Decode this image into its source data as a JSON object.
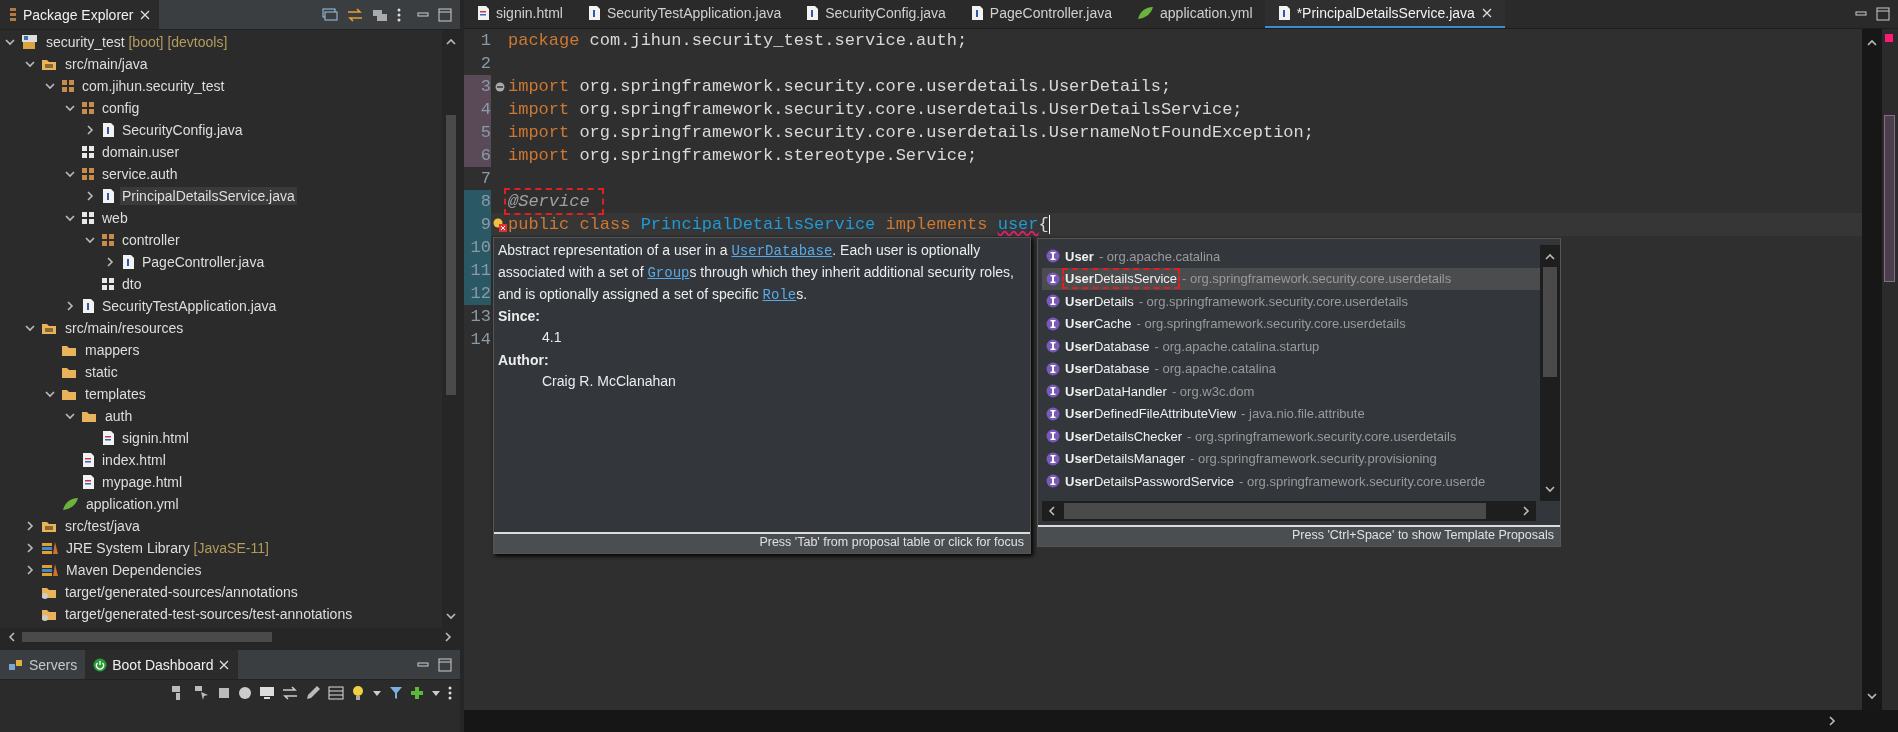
{
  "explorer": {
    "title": "Package Explorer",
    "tree": [
      {
        "label": "security_test",
        "decoration": "[boot] [devtools]",
        "kind": "project",
        "expanded": true,
        "selected": false,
        "children": [
          {
            "label": "src/main/java",
            "kind": "srcfolder",
            "expanded": true,
            "selected": false,
            "children": [
              {
                "label": "com.jihun.security_test",
                "kind": "package",
                "expanded": true,
                "selected": false,
                "children": [
                  {
                    "label": "config",
                    "kind": "package",
                    "expanded": true,
                    "selected": false,
                    "children": [
                      {
                        "label": "SecurityConfig.java",
                        "kind": "java",
                        "expanded": false,
                        "selected": false
                      }
                    ]
                  },
                  {
                    "label": "domain.user",
                    "kind": "emptypackage",
                    "selected": false
                  },
                  {
                    "label": "service.auth",
                    "kind": "package",
                    "expanded": true,
                    "selected": false,
                    "children": [
                      {
                        "label": "PrincipalDetailsService.java",
                        "kind": "java",
                        "expanded": false,
                        "selected": true
                      }
                    ]
                  },
                  {
                    "label": "web",
                    "kind": "emptypackage",
                    "expanded": true,
                    "selected": false,
                    "children": [
                      {
                        "label": "controller",
                        "kind": "package",
                        "expanded": true,
                        "selected": false,
                        "children": [
                          {
                            "label": "PageController.java",
                            "kind": "java",
                            "expanded": false,
                            "selected": false
                          }
                        ]
                      },
                      {
                        "label": "dto",
                        "kind": "emptypackage",
                        "selected": false
                      }
                    ]
                  },
                  {
                    "label": "SecurityTestApplication.java",
                    "kind": "java",
                    "expanded": false,
                    "selected": false
                  }
                ]
              }
            ]
          },
          {
            "label": "src/main/resources",
            "kind": "srcfolder",
            "expanded": true,
            "selected": false,
            "children": [
              {
                "label": "mappers",
                "kind": "folder",
                "selected": false
              },
              {
                "label": "static",
                "kind": "folder",
                "selected": false
              },
              {
                "label": "templates",
                "kind": "folder",
                "expanded": true,
                "selected": false,
                "children": [
                  {
                    "label": "auth",
                    "kind": "folder",
                    "expanded": true,
                    "selected": false,
                    "children": [
                      {
                        "label": "signin.html",
                        "kind": "html",
                        "selected": false
                      }
                    ]
                  },
                  {
                    "label": "index.html",
                    "kind": "html",
                    "selected": false
                  },
                  {
                    "label": "mypage.html",
                    "kind": "html",
                    "selected": false
                  }
                ]
              },
              {
                "label": "application.yml",
                "kind": "yml",
                "selected": false
              }
            ]
          },
          {
            "label": "src/test/java",
            "kind": "srcfolder",
            "expanded": false,
            "selected": false
          },
          {
            "label": "JRE System Library",
            "decoration": "[JavaSE-11]",
            "kind": "library",
            "expanded": false,
            "selected": false
          },
          {
            "label": "Maven Dependencies",
            "kind": "library",
            "expanded": false,
            "selected": false
          },
          {
            "label": "target/generated-sources/annotations",
            "kind": "genfolder",
            "selected": false
          },
          {
            "label": "target/generated-test-sources/test-annotations",
            "kind": "genfolder",
            "selected": false
          }
        ]
      }
    ]
  },
  "bottom_panel": {
    "tabs": [
      {
        "label": "Servers",
        "selected": false
      },
      {
        "label": "Boot Dashboard",
        "selected": true
      }
    ]
  },
  "editor": {
    "tabs": [
      {
        "label": "signin.html",
        "kind": "html",
        "selected": false
      },
      {
        "label": "SecurityTestApplication.java",
        "kind": "java",
        "selected": false
      },
      {
        "label": "SecurityConfig.java",
        "kind": "java",
        "selected": false
      },
      {
        "label": "PageController.java",
        "kind": "java",
        "selected": false
      },
      {
        "label": "application.yml",
        "kind": "yml",
        "selected": false
      },
      {
        "label": "*PrincipalDetailsService.java",
        "kind": "java",
        "selected": true
      }
    ],
    "lines": [
      {
        "number": "1",
        "current": false,
        "kind": "plain",
        "tokens": [
          {
            "kind": "keyword",
            "text": "package"
          },
          {
            "kind": "plain",
            "text": " com.jihun.security_test.service.auth;"
          }
        ]
      },
      {
        "number": "2",
        "current": false,
        "kind": "plain"
      },
      {
        "number": "3",
        "current": false,
        "kind": "changed",
        "folded": false,
        "tokens": [
          {
            "kind": "keyword",
            "text": "import"
          },
          {
            "kind": "plain",
            "text": " org.springframework.security.core.userdetails.UserDetails;"
          }
        ]
      },
      {
        "number": "4",
        "current": false,
        "kind": "changed",
        "tokens": [
          {
            "kind": "keyword",
            "text": "import"
          },
          {
            "kind": "plain",
            "text": " org.springframework.security.core.userdetails.UserDetailsService;"
          }
        ]
      },
      {
        "number": "5",
        "current": false,
        "kind": "changed",
        "tokens": [
          {
            "kind": "keyword",
            "text": "import"
          },
          {
            "kind": "plain",
            "text": " org.springframework.security.core.userdetails.UsernameNotFoundException;"
          }
        ]
      },
      {
        "number": "6",
        "current": false,
        "kind": "changed",
        "tokens": [
          {
            "kind": "keyword",
            "text": "import"
          },
          {
            "kind": "plain",
            "text": " org.springframework.stereotype.Service;"
          }
        ]
      },
      {
        "number": "7",
        "current": false,
        "kind": "plain"
      },
      {
        "number": "8",
        "current": false,
        "kind": "added",
        "tokens": [
          {
            "kind": "annotation",
            "text": "@Service ",
            "boxed": true
          }
        ]
      },
      {
        "number": "9",
        "current": true,
        "kind": "added",
        "error": true,
        "tokens": [
          {
            "kind": "keyword",
            "text": "public "
          },
          {
            "kind": "keyword",
            "text": "class "
          },
          {
            "kind": "type",
            "text": "PrincipalDetailsService "
          },
          {
            "kind": "keyword",
            "text": "implements "
          },
          {
            "kind": "error",
            "text": "user"
          },
          {
            "kind": "plain",
            "text": "{"
          }
        ]
      },
      {
        "number": "10",
        "kind": "added"
      },
      {
        "number": "11",
        "kind": "added"
      },
      {
        "number": "12",
        "kind": "added"
      },
      {
        "number": "13",
        "kind": "plain"
      },
      {
        "number": "14",
        "kind": "plain"
      }
    ],
    "doc_popup": {
      "paragraph": [
        {
          "kind": "text",
          "text": "Abstract representation of a user in a "
        },
        {
          "kind": "link",
          "text": "UserDatabase"
        },
        {
          "kind": "text",
          "text": ". Each user is optionally associated with a set of "
        },
        {
          "kind": "link",
          "text": "Group"
        },
        {
          "kind": "text",
          "text": "s through which they inherit additional security roles, and is optionally assigned a set of specific "
        },
        {
          "kind": "link",
          "text": "Role"
        },
        {
          "kind": "text",
          "text": "s."
        }
      ],
      "sections": [
        {
          "heading": "Since:",
          "value": "4.1"
        },
        {
          "heading": "Author:",
          "value": "Craig R. McClanahan"
        }
      ],
      "footer": "Press 'Tab' from proposal table or click for focus"
    },
    "proposals": {
      "items": [
        {
          "name": "**User**",
          "qualifier": "- org.apache.catalina",
          "selected": false
        },
        {
          "name": "**User**DetailsService",
          "qualifier": "- org.springframework.security.core.userdetails",
          "selected": true,
          "boxed": true
        },
        {
          "name": "**User**Details",
          "qualifier": "- org.springframework.security.core.userdetails",
          "selected": false
        },
        {
          "name": "**User**Cache",
          "qualifier": "- org.springframework.security.core.userdetails",
          "selected": false
        },
        {
          "name": "**User**Database",
          "qualifier": "- org.apache.catalina.startup",
          "selected": false
        },
        {
          "name": "**User**Database",
          "qualifier": "- org.apache.catalina",
          "selected": false
        },
        {
          "name": "**User**DataHandler",
          "qualifier": "- org.w3c.dom",
          "selected": false
        },
        {
          "name": "**User**DefinedFileAttributeView",
          "qualifier": "- java.nio.file.attribute",
          "selected": false
        },
        {
          "name": "**User**DetailsChecker",
          "qualifier": "- org.springframework.security.core.userdetails",
          "selected": false
        },
        {
          "name": "**User**DetailsManager",
          "qualifier": "- org.springframework.security.provisioning",
          "selected": false
        },
        {
          "name": "**User**DetailsPasswordService",
          "qualifier": "- org.springframework.security.core.userde",
          "selected": false
        }
      ],
      "footer": "Press 'Ctrl+Space' to show Template Proposals"
    }
  }
}
